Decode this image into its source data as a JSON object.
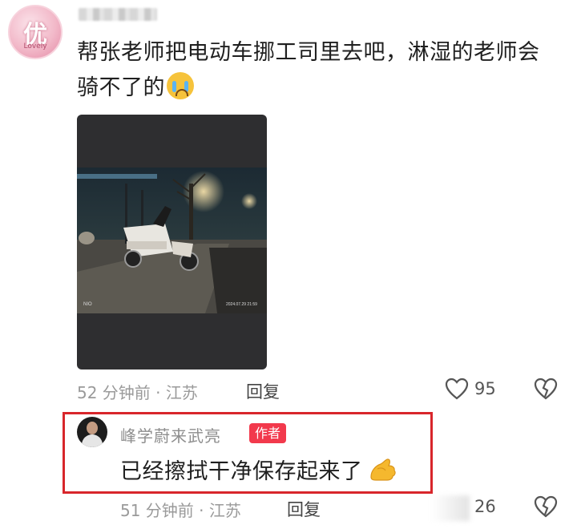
{
  "comment": {
    "username": "",
    "avatar_glyph": "优",
    "avatar_caption": "Lovely",
    "text": "帮张老师把电动车挪工司里去吧，淋湿的老师会骑不了的",
    "emoji": "crying-face-icon",
    "time": "52 分钟前 · 江苏",
    "reply_label": "回复",
    "like_count": "95"
  },
  "reply": {
    "author": "峰学蔚来武亮",
    "badge": "作者",
    "text": "已经擦拭干净保存起来了",
    "emoji": "thumbs-up-hand-icon",
    "time": "51 分钟前 · 江苏",
    "reply_label": "回复",
    "like_count": "26"
  },
  "photo": {
    "watermark_left": "NIO",
    "watermark_right": "2024.07.29 21:59"
  },
  "colors": {
    "author_badge": "#f2394c",
    "highlight": "#d8262b",
    "meta_gray": "#9a9a9a"
  }
}
